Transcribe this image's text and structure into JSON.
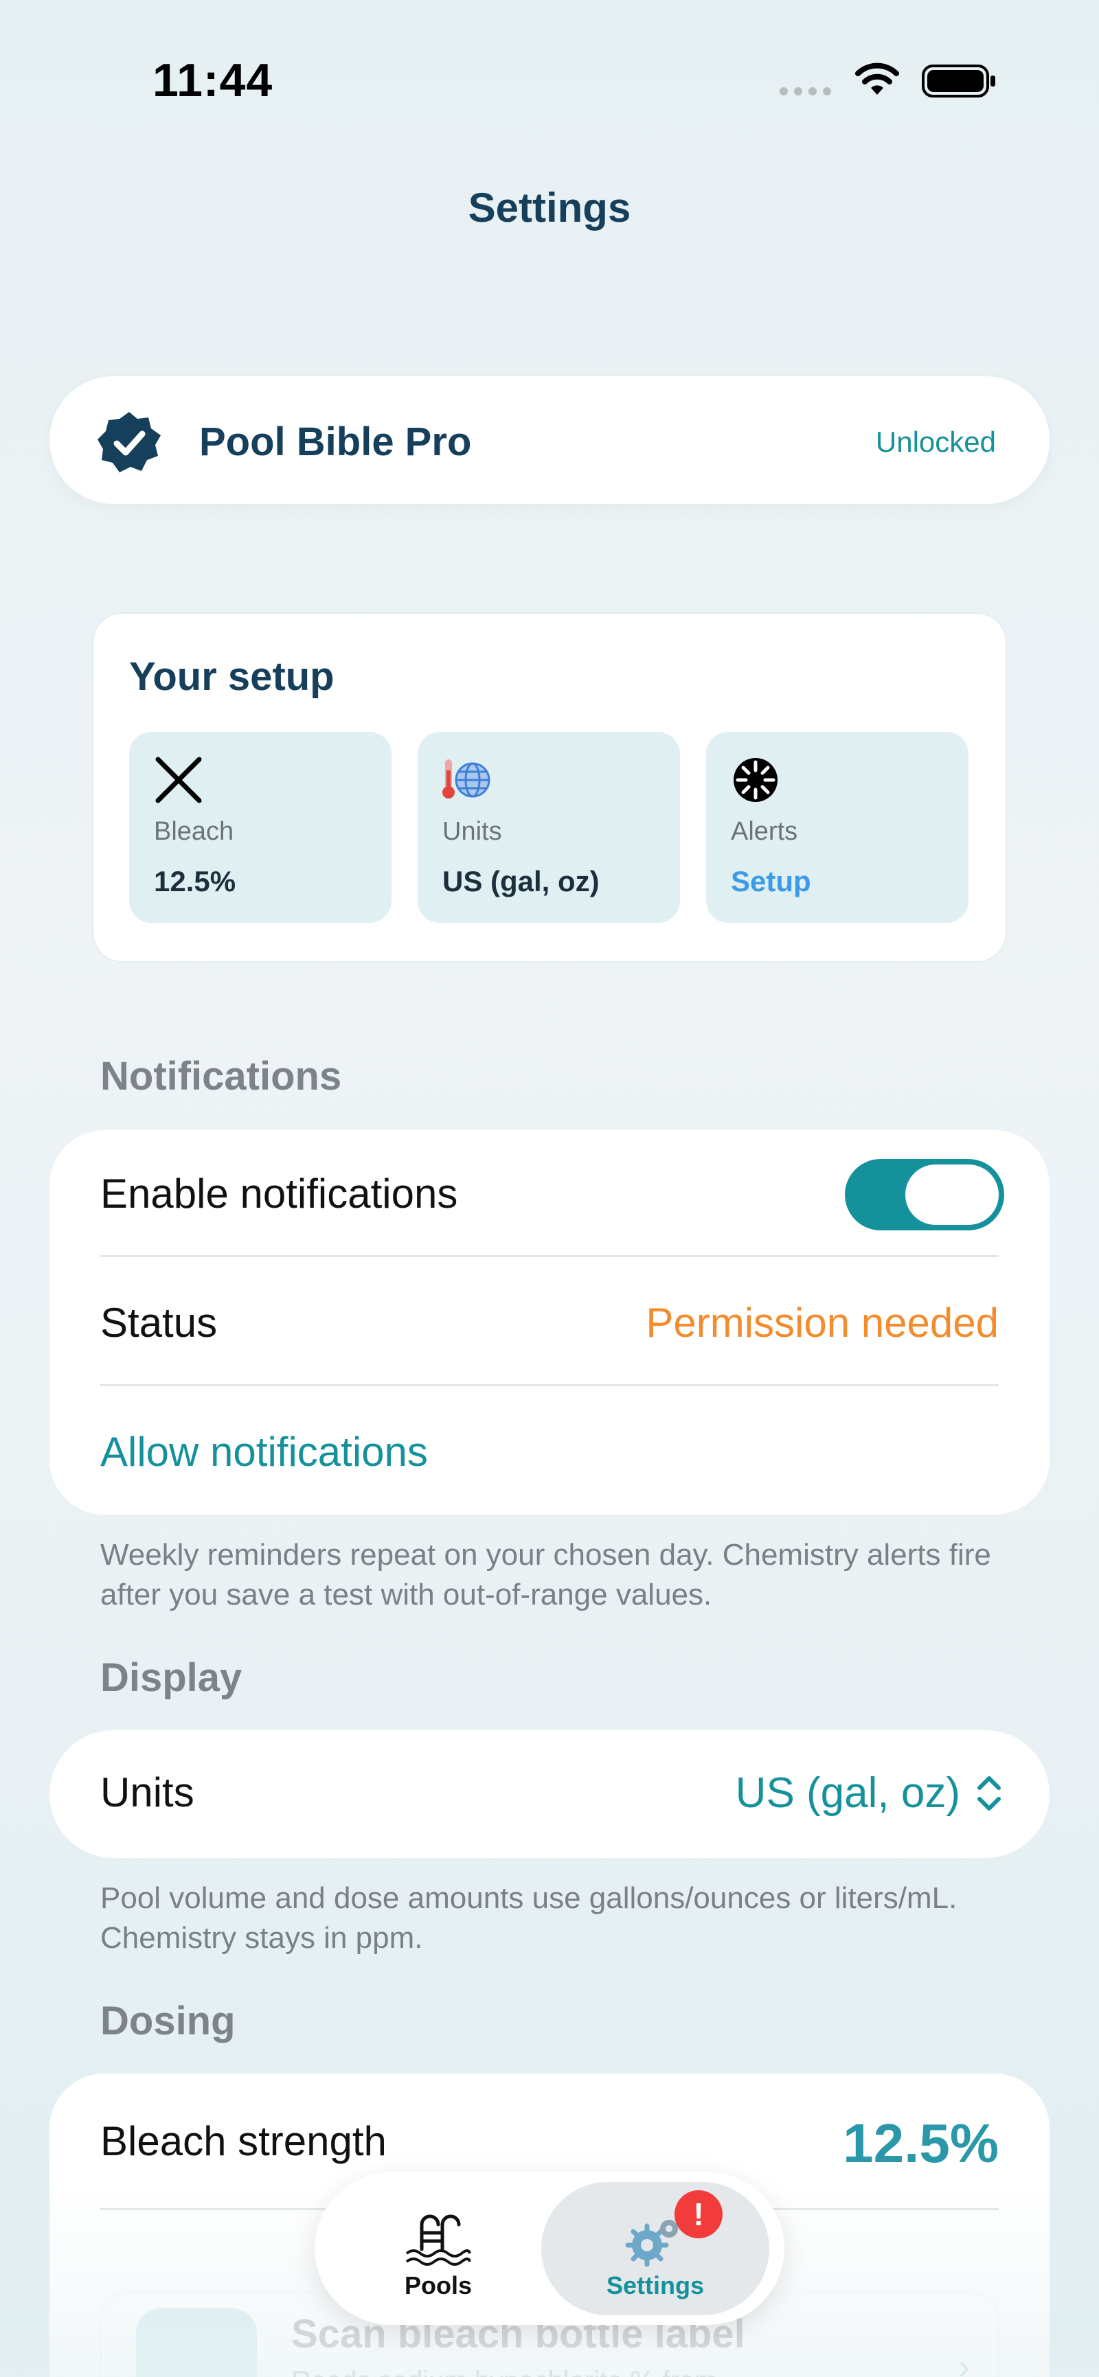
{
  "status_bar": {
    "time": "11:44"
  },
  "header": {
    "title": "Settings"
  },
  "pro": {
    "title": "Pool Bible Pro",
    "status": "Unlocked"
  },
  "setup": {
    "title": "Your setup",
    "tiles": [
      {
        "label": "Bleach",
        "value": "12.5%",
        "icon": "close-x-icon"
      },
      {
        "label": "Units",
        "value": "US (gal, oz)",
        "icon": "globe-thermometer-icon"
      },
      {
        "label": "Alerts",
        "value": "Setup",
        "icon": "clock-dial-icon"
      }
    ]
  },
  "notifications": {
    "header": "Notifications",
    "enable_label": "Enable notifications",
    "enabled": true,
    "status_label": "Status",
    "status_value": "Permission needed",
    "allow_link": "Allow notifications",
    "footnote": "Weekly reminders repeat on your chosen day. Chemistry alerts fire after you save a test with out-of-range values."
  },
  "display": {
    "header": "Display",
    "units_label": "Units",
    "units_value": "US (gal, oz)",
    "footnote": "Pool volume and dose amounts use gallons/ounces or liters/mL. Chemistry stays in ppm."
  },
  "dosing": {
    "header": "Dosing",
    "bleach_label": "Bleach strength",
    "bleach_value": "12.5%",
    "scan_title": "Scan bleach bottle label",
    "scan_subtitle": "Reads sodium hypochlorite % from"
  },
  "tab_bar": {
    "tabs": [
      {
        "label": "Pools",
        "icon": "pool-ladder-icon",
        "active": false
      },
      {
        "label": "Settings",
        "icon": "gears-icon",
        "active": true,
        "badge": "!"
      }
    ]
  },
  "colors": {
    "accent": "#15919b",
    "title": "#163f5c",
    "warning": "#f28c2c",
    "badge": "#f23b3b",
    "alerts_setup": "#3c9be8"
  }
}
